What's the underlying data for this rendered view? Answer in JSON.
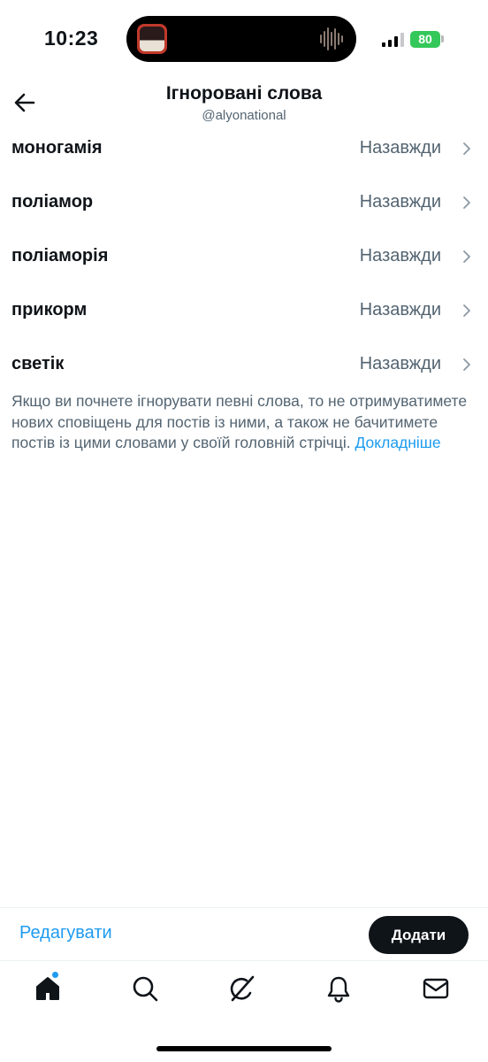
{
  "status_bar": {
    "time": "10:23",
    "battery_level": "80",
    "icons": [
      "signal-bars-icon",
      "battery-icon",
      "soundwave-icon"
    ]
  },
  "header": {
    "title": "Ігноровані слова",
    "handle": "@alyonational",
    "back_icon": "arrow-left-icon"
  },
  "muted_words": [
    {
      "word": "моногамія",
      "duration": "Назавжди"
    },
    {
      "word": "поліамор",
      "duration": "Назавжди"
    },
    {
      "word": "поліаморія",
      "duration": "Назавжди"
    },
    {
      "word": "прикорм",
      "duration": "Назавжди"
    },
    {
      "word": "светік",
      "duration": "Назавжди"
    }
  ],
  "info": {
    "text": "Якщо ви почнете ігнорувати певні слова, то не отримуватимете нових сповіщень для постів із ними, а також не бачитимете постів із цими словами у своїй головній стрічці. ",
    "link": "Докладніше"
  },
  "actions": {
    "edit_label": "Редагувати",
    "add_label": "Додати"
  },
  "tab_bar": {
    "items": [
      "home-icon",
      "search-icon",
      "grok-icon",
      "notifications-icon",
      "messages-icon"
    ]
  },
  "colors": {
    "accent": "#1d9bf0",
    "text_primary": "#0f1419",
    "text_secondary": "#536471",
    "battery": "#34c759"
  }
}
